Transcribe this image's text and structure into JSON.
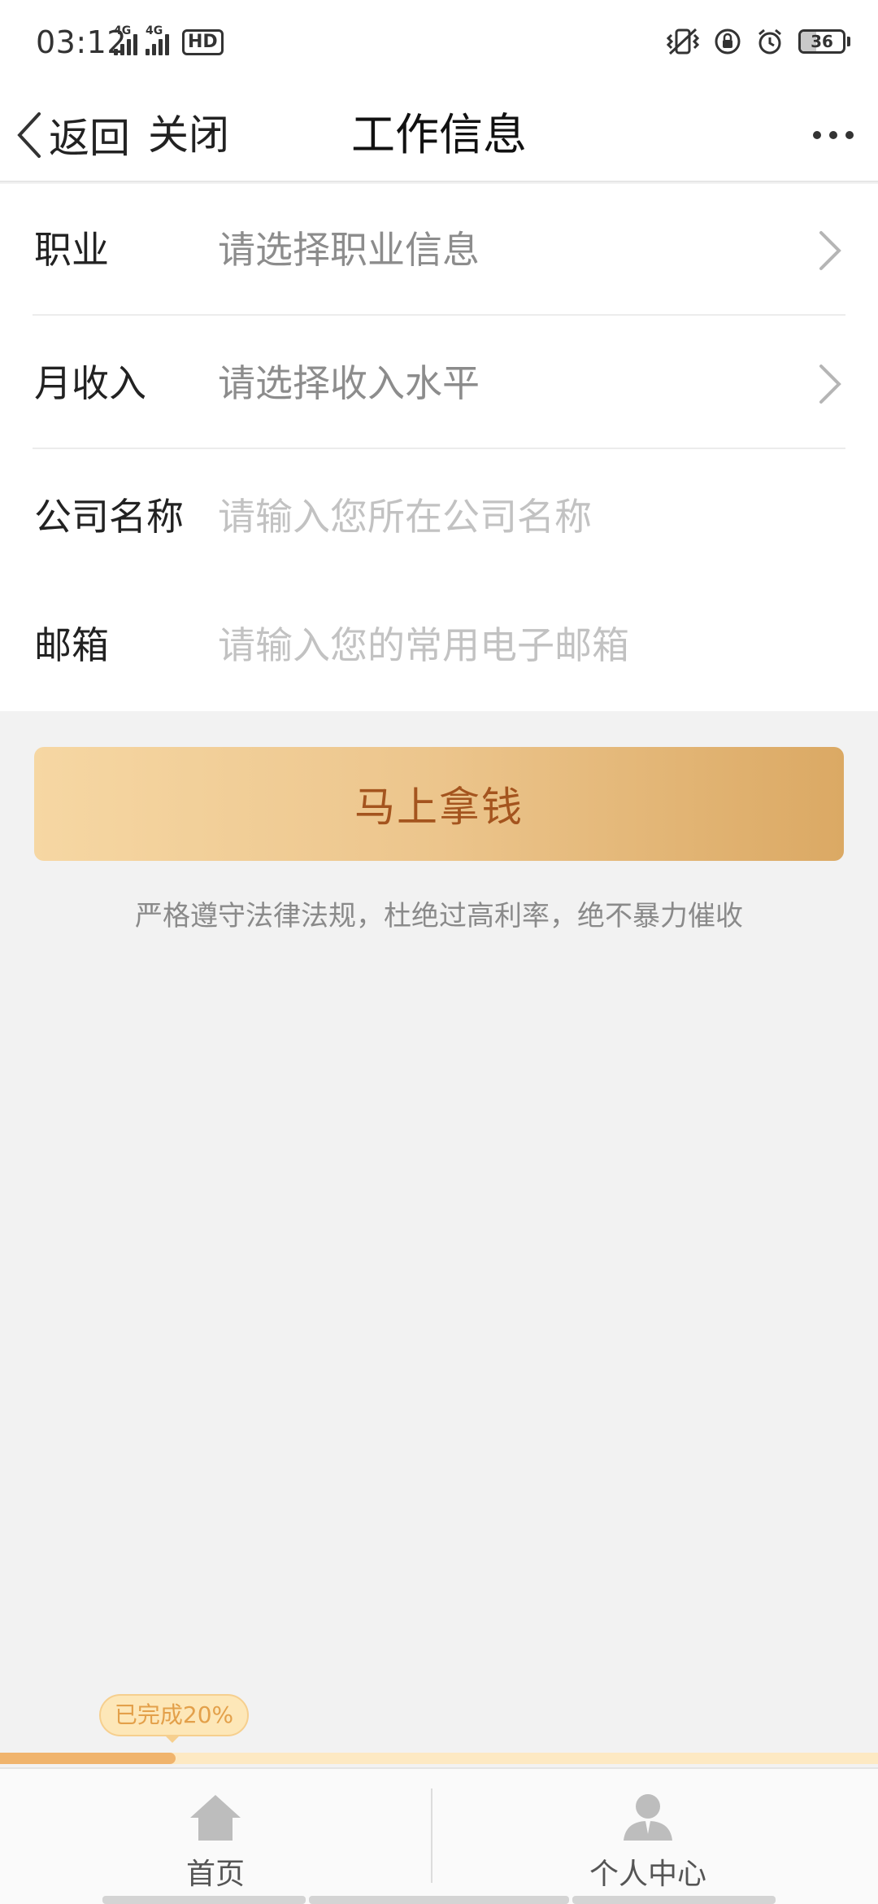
{
  "status_bar": {
    "time": "03:12",
    "network_1": "4G",
    "network_2": "4G",
    "hd_label": "HD",
    "battery_level": "36",
    "icons": [
      "vibrate-icon",
      "rotation-lock-icon",
      "alarm-icon"
    ]
  },
  "nav": {
    "back_label": "返回",
    "close_label": "关闭",
    "title": "工作信息"
  },
  "form": {
    "occupation": {
      "label": "职业",
      "value": "请选择职业信息"
    },
    "income": {
      "label": "月收入",
      "value": "请选择收入水平"
    },
    "company": {
      "label": "公司名称",
      "placeholder": "请输入您所在公司名称"
    },
    "email": {
      "label": "邮箱",
      "placeholder": "请输入您的常用电子邮箱"
    }
  },
  "submit_label": "马上拿钱",
  "disclaimer": "严格遵守法律法规，杜绝过高利率，绝不暴力催收",
  "progress": {
    "label": "已完成20%",
    "percent": 20
  },
  "tabs": [
    {
      "label": "首页",
      "icon": "home-icon"
    },
    {
      "label": "个人中心",
      "icon": "user-icon"
    }
  ],
  "colors": {
    "accent_text": "#a4541e",
    "button_start": "#f6d7a3",
    "button_end": "#dba964",
    "progress_fill": "#f0b46d",
    "progress_track": "#fde9c3"
  }
}
